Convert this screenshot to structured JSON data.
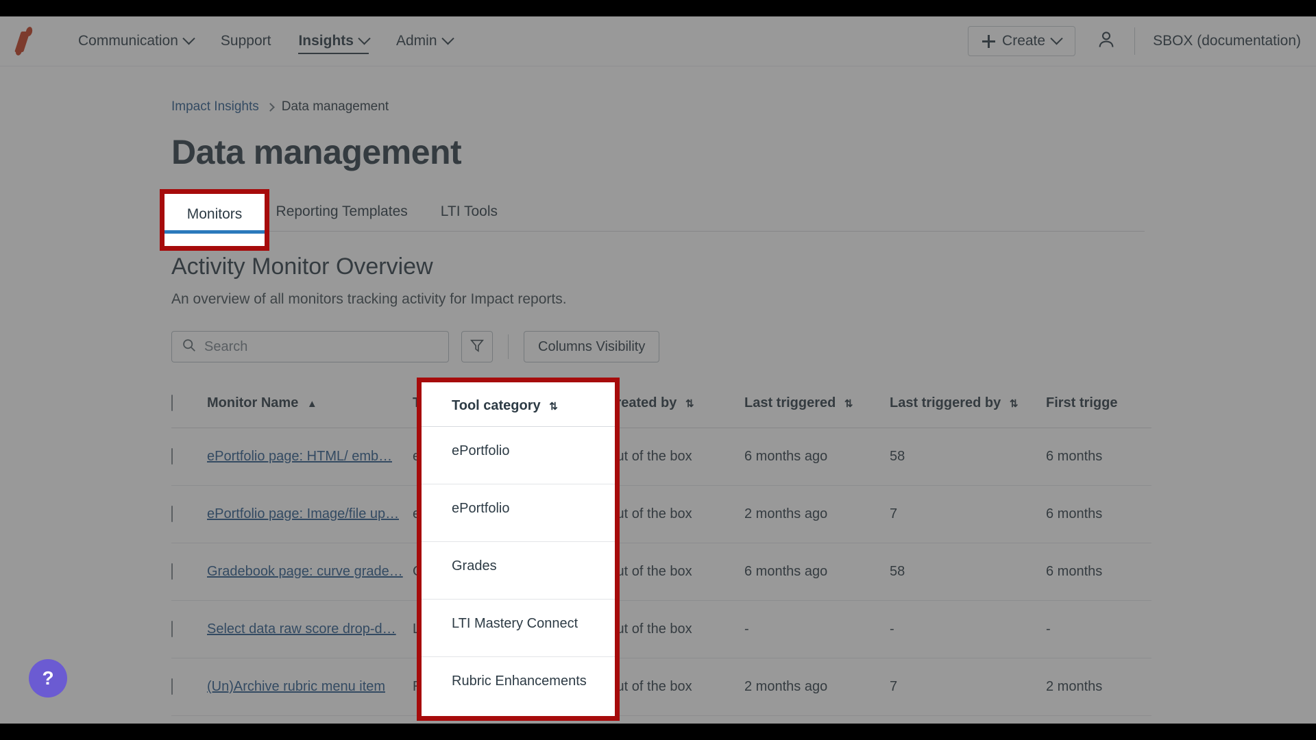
{
  "nav": {
    "logo_alt": "instructure-logo",
    "items": [
      {
        "label": "Communication",
        "has_caret": true,
        "active": false
      },
      {
        "label": "Support",
        "has_caret": false,
        "active": false
      },
      {
        "label": "Insights",
        "has_caret": true,
        "active": true
      },
      {
        "label": "Admin",
        "has_caret": true,
        "active": false
      }
    ],
    "create_label": "Create",
    "account_label": "SBOX (documentation)"
  },
  "breadcrumb": {
    "parent": "Impact Insights",
    "current": "Data management"
  },
  "page": {
    "title": "Data management",
    "section_title": "Activity Monitor Overview",
    "section_subtitle": "An overview of all monitors tracking activity for Impact reports."
  },
  "tabs": [
    {
      "label": "Monitors",
      "active": true
    },
    {
      "label": "Reporting Templates",
      "active": false
    },
    {
      "label": "LTI Tools",
      "active": false
    }
  ],
  "toolbar": {
    "search_placeholder": "Search",
    "search_value": "",
    "filter_icon": "filter-icon",
    "columns_label": "Columns Visibility"
  },
  "table": {
    "columns": [
      {
        "key": "checkbox",
        "label": "",
        "sortable": false
      },
      {
        "key": "name",
        "label": "Monitor Name",
        "sort": "asc"
      },
      {
        "key": "category",
        "label": "Tool category",
        "sort": "none"
      },
      {
        "key": "created_by",
        "label": "Created by",
        "sort": "none"
      },
      {
        "key": "last_triggered",
        "label": "Last triggered",
        "sort": "none"
      },
      {
        "key": "last_triggered_by",
        "label": "Last triggered by",
        "sort": "none"
      },
      {
        "key": "first_triggered",
        "label": "First trigge",
        "sort": "none"
      }
    ],
    "rows": [
      {
        "name": "ePortfolio page: HTML/ emb…",
        "category": "ePortfolio",
        "created_by": "Out of the box",
        "last_triggered": "6 months ago",
        "last_triggered_by": "58",
        "first_triggered": "6 months "
      },
      {
        "name": "ePortfolio page: Image/file up…",
        "category": "ePortfolio",
        "created_by": "Out of the box",
        "last_triggered": "2 months ago",
        "last_triggered_by": "7",
        "first_triggered": "6 months "
      },
      {
        "name": "Gradebook page: curve grade…",
        "category": "Grades",
        "created_by": "Out of the box",
        "last_triggered": "6 months ago",
        "last_triggered_by": "58",
        "first_triggered": "6 months "
      },
      {
        "name": "Select data raw score drop-d…",
        "category": "LTI Mastery Connect",
        "created_by": "Out of the box",
        "last_triggered": "-",
        "last_triggered_by": "-",
        "first_triggered": "-"
      },
      {
        "name": "(Un)Archive rubric menu item",
        "category": "Rubric Enhancements",
        "created_by": "Out of the box",
        "last_triggered": "2 months ago",
        "last_triggered_by": "7",
        "first_triggered": "2 months "
      }
    ]
  },
  "help": {
    "label": "?"
  },
  "colors": {
    "highlight_border": "#A60B0B",
    "tab_underline": "#2B7ABC",
    "link": "#2B5B8C",
    "text": "#2D3B45",
    "logo": "#C23C1E",
    "help_bubble": "#6B5BD2"
  }
}
